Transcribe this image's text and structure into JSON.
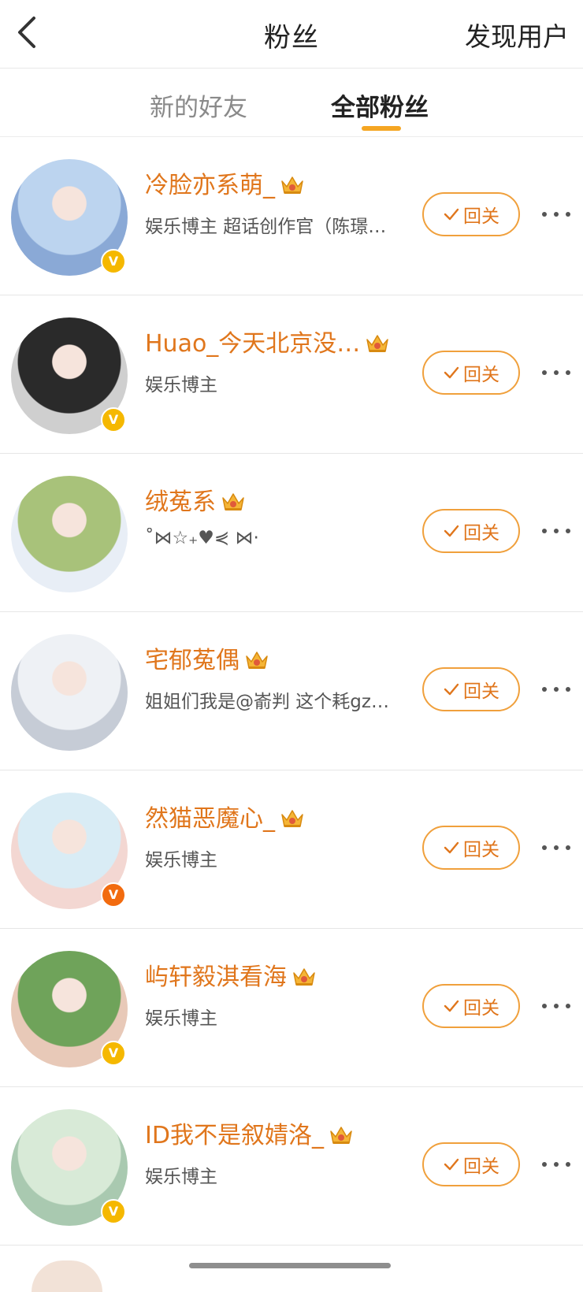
{
  "nav": {
    "title": "粉丝",
    "discover_label": "发现用户"
  },
  "tabs": [
    {
      "label": "新的好友",
      "active": false
    },
    {
      "label": "全部粉丝",
      "active": true
    }
  ],
  "colors": {
    "accent": "#f5a623",
    "name": "#e0761c",
    "verified_gold": "#f5b800",
    "verified_orange": "#f26b0f"
  },
  "fans": [
    {
      "name": "冷脸亦系萌_",
      "desc": "娱乐博主 超话创作官（陈璟…",
      "button": "回关",
      "verified": "gold",
      "avatar_bg": [
        "#bcd4ef",
        "#8aa9d6"
      ]
    },
    {
      "name": "Huao_今天北京没…",
      "desc": "娱乐博主",
      "button": "回关",
      "verified": "gold",
      "avatar_bg": [
        "#2a2a2a",
        "#cfcfcf"
      ]
    },
    {
      "name": "绒菟系",
      "desc": "˚⋈☆₊♥⋞ ⋈·",
      "button": "回关",
      "verified": "none",
      "avatar_bg": [
        "#a8c27a",
        "#e8eef6"
      ]
    },
    {
      "name": "宅郁菟偶",
      "desc": "姐姐们我是@嵛判 这个耗gz…",
      "button": "回关",
      "verified": "none",
      "avatar_bg": [
        "#eef1f5",
        "#c6ccd6"
      ]
    },
    {
      "name": "然猫恶魔心_",
      "desc": "娱乐博主",
      "button": "回关",
      "verified": "orange",
      "avatar_bg": [
        "#d9ecf5",
        "#f3d7d2"
      ]
    },
    {
      "name": "屿轩毅淇看海",
      "desc": "娱乐博主",
      "button": "回关",
      "verified": "gold",
      "avatar_bg": [
        "#6fa35a",
        "#e8c9b8"
      ]
    },
    {
      "name": "ID我不是叙婧洛_",
      "desc": "娱乐博主",
      "button": "回关",
      "verified": "gold",
      "avatar_bg": [
        "#d8ead7",
        "#a9c9b0"
      ]
    }
  ]
}
